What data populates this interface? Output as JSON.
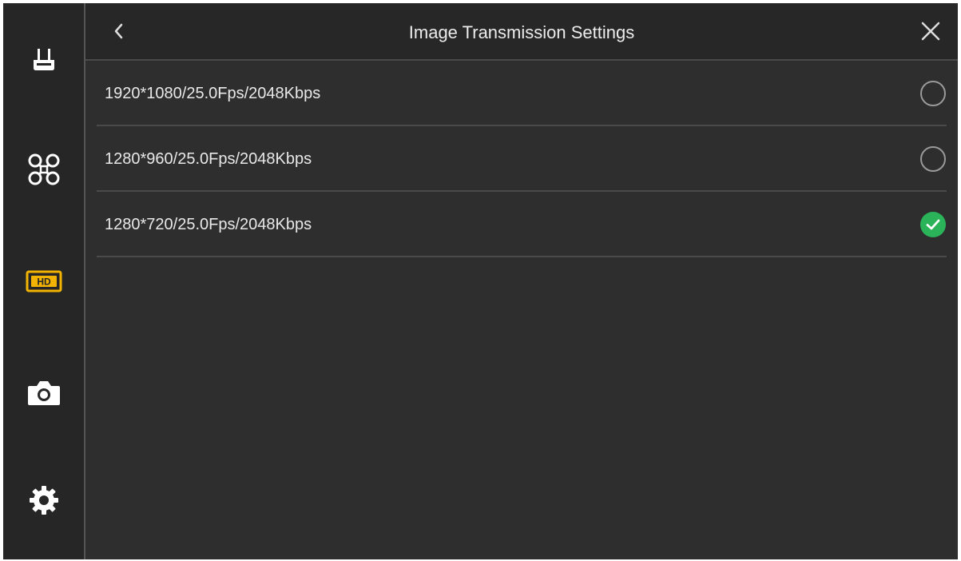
{
  "header": {
    "title": "Image Transmission Settings",
    "back_icon": "chevron-left-icon",
    "close_icon": "close-icon"
  },
  "sidebar": {
    "items": [
      {
        "id": "remote-controller",
        "icon": "remote-controller-icon",
        "active": false
      },
      {
        "id": "aircraft",
        "icon": "drone-icon",
        "active": false
      },
      {
        "id": "image-transmission",
        "icon": "hd-icon",
        "active": true,
        "badge_text": "HD"
      },
      {
        "id": "camera",
        "icon": "camera-icon",
        "active": false
      },
      {
        "id": "general-settings",
        "icon": "gear-icon",
        "active": false
      }
    ]
  },
  "options": [
    {
      "label": "1920*1080/25.0Fps/2048Kbps",
      "selected": false
    },
    {
      "label": "1280*960/25.0Fps/2048Kbps",
      "selected": false
    },
    {
      "label": "1280*720/25.0Fps/2048Kbps",
      "selected": true
    }
  ],
  "colors": {
    "accent_active": "#f2b400",
    "selected_check": "#2bb35a",
    "icon": "#ffffff",
    "radio_border": "#9a9a9a",
    "background": "#2e2e2e"
  }
}
